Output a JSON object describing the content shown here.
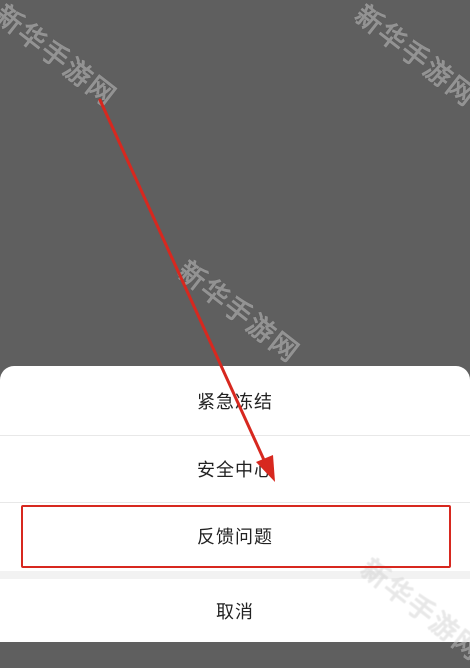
{
  "watermark": {
    "text": "新华手游网"
  },
  "action_sheet": {
    "items": [
      {
        "label": "紧急冻结"
      },
      {
        "label": "安全中心"
      },
      {
        "label": "反馈问题"
      }
    ],
    "cancel_label": "取消"
  },
  "annotation": {
    "color": "#d7281f"
  }
}
